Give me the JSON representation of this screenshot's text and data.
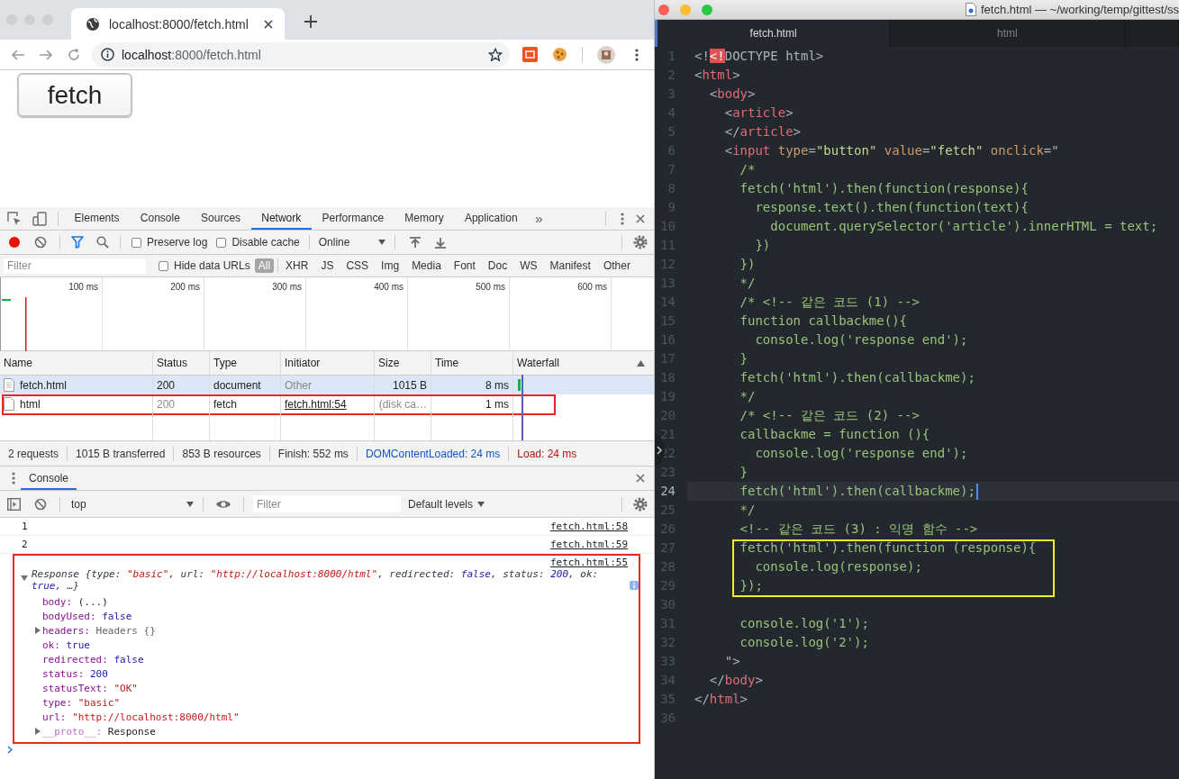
{
  "browser": {
    "tab_title": "localhost:8000/fetch.html",
    "url_host": "localhost",
    "url_path": ":8000/fetch.html"
  },
  "page": {
    "button_label": "fetch"
  },
  "devtools": {
    "tabs": [
      {
        "label": "Elements",
        "selected": false
      },
      {
        "label": "Console",
        "selected": false
      },
      {
        "label": "Sources",
        "selected": false
      },
      {
        "label": "Network",
        "selected": true
      },
      {
        "label": "Performance",
        "selected": false
      },
      {
        "label": "Memory",
        "selected": false
      },
      {
        "label": "Application",
        "selected": false
      }
    ],
    "more": "»",
    "recording": true,
    "preserve_log": {
      "label": "Preserve log",
      "checked": false
    },
    "disable_cache": {
      "label": "Disable cache",
      "checked": false
    },
    "throttling": "Online",
    "filter_placeholder": "Filter",
    "hide_data_urls": {
      "label": "Hide data URLs",
      "checked": false
    },
    "types": [
      {
        "label": "All",
        "selected": true
      },
      {
        "label": "XHR",
        "selected": false
      },
      {
        "label": "JS",
        "selected": false
      },
      {
        "label": "CSS",
        "selected": false
      },
      {
        "label": "Img",
        "selected": false
      },
      {
        "label": "Media",
        "selected": false
      },
      {
        "label": "Font",
        "selected": false
      },
      {
        "label": "Doc",
        "selected": false
      },
      {
        "label": "WS",
        "selected": false
      },
      {
        "label": "Manifest",
        "selected": false
      },
      {
        "label": "Other",
        "selected": false
      }
    ],
    "overview_ticks": [
      "100 ms",
      "200 ms",
      "300 ms",
      "400 ms",
      "500 ms",
      "600 ms"
    ],
    "table": {
      "columns": [
        "Name",
        "Status",
        "Type",
        "Initiator",
        "Size",
        "Time",
        "Waterfall"
      ],
      "rows": [
        {
          "name": "fetch.html",
          "status": "200",
          "type": "document",
          "initiator": "Other",
          "initiator_link": false,
          "size": "1015 B",
          "time": "8 ms",
          "from_cache": false,
          "selected": true,
          "outlined": false
        },
        {
          "name": "html",
          "status": "200",
          "type": "fetch",
          "initiator": "fetch.html:54",
          "initiator_link": true,
          "size": "(disk ca…",
          "time": "1 ms",
          "from_cache": true,
          "selected": false,
          "outlined": true
        }
      ]
    },
    "summary": [
      {
        "text": "2 requests",
        "kind": "plain"
      },
      {
        "text": "1015 B transferred",
        "kind": "plain"
      },
      {
        "text": "853 B resources",
        "kind": "plain"
      },
      {
        "text": "Finish: 552 ms",
        "kind": "plain"
      },
      {
        "text": "DOMContentLoaded: 24 ms",
        "kind": "dcl"
      },
      {
        "text": "Load: 24 ms",
        "kind": "load"
      }
    ]
  },
  "console": {
    "tab": "Console",
    "context": "top",
    "filter_placeholder": "Filter",
    "levels": "Default levels",
    "messages": [
      {
        "kind": "log",
        "text": "1",
        "source": "fetch.html:58",
        "outlined": false
      },
      {
        "kind": "log",
        "text": "2",
        "source": "fetch.html:59",
        "outlined": false
      },
      {
        "kind": "object",
        "source": "fetch.html:55",
        "outlined": true,
        "expanded": true,
        "summary": [
          {
            "text": "Response {type: ",
            "kind": "text"
          },
          {
            "text": "\"basic\"",
            "kind": "string"
          },
          {
            "text": ", url: ",
            "kind": "text"
          },
          {
            "text": "\"http://localhost:8000/html\"",
            "kind": "string"
          },
          {
            "text": ", redirected: ",
            "kind": "text"
          },
          {
            "text": "false",
            "kind": "literal"
          },
          {
            "text": ", status: ",
            "kind": "text"
          },
          {
            "text": "200",
            "kind": "literal"
          },
          {
            "text": ", ok: ",
            "kind": "text"
          },
          {
            "text": "true",
            "kind": "literal"
          },
          {
            "text": ", …}",
            "kind": "text"
          }
        ],
        "properties": [
          {
            "key": "body:",
            "value": {
              "text": "(...)",
              "kind": "plain"
            },
            "kind": "value",
            "internal": false
          },
          {
            "key": "bodyUsed:",
            "value": {
              "text": "false",
              "kind": "literal"
            },
            "kind": "value",
            "internal": false
          },
          {
            "key": "headers:",
            "value": {
              "text": "Headers {}",
              "kind": "object"
            },
            "kind": "expandable",
            "expanded": false,
            "internal": false
          },
          {
            "key": "ok:",
            "value": {
              "text": "true",
              "kind": "literal"
            },
            "kind": "value",
            "internal": false
          },
          {
            "key": "redirected:",
            "value": {
              "text": "false",
              "kind": "literal"
            },
            "kind": "value",
            "internal": false
          },
          {
            "key": "status:",
            "value": {
              "text": "200",
              "kind": "literal"
            },
            "kind": "value",
            "internal": false
          },
          {
            "key": "statusText:",
            "value": {
              "text": "\"OK\"",
              "kind": "string"
            },
            "kind": "value",
            "internal": false
          },
          {
            "key": "type:",
            "value": {
              "text": "\"basic\"",
              "kind": "string"
            },
            "kind": "value",
            "internal": false
          },
          {
            "key": "url:",
            "value": {
              "text": "\"http://localhost:8000/html\"",
              "kind": "string"
            },
            "kind": "value",
            "internal": false
          },
          {
            "key": "__proto__:",
            "value": {
              "text": "Response",
              "kind": "plain"
            },
            "kind": "expandable",
            "expanded": false,
            "internal": true
          }
        ]
      }
    ]
  },
  "editor": {
    "title": "fetch.html — ~/working/temp/gittest/ss",
    "tabs": [
      {
        "label": "fetch.html",
        "selected": true
      },
      {
        "label": "html",
        "selected": false
      }
    ],
    "lines": [
      {
        "kind": "line",
        "number": "1",
        "current": false,
        "tokens": [
          {
            "text": "<!",
            "kind": "plain"
          },
          {
            "text": "<!",
            "kind": "error"
          },
          {
            "text": "DOCTYPE html>",
            "kind": "plain"
          }
        ]
      },
      {
        "kind": "line",
        "number": "2",
        "current": false,
        "tokens": [
          {
            "text": "<",
            "kind": "plain"
          },
          {
            "text": "html",
            "kind": "tag"
          },
          {
            "text": ">",
            "kind": "plain"
          }
        ]
      },
      {
        "kind": "line",
        "number": "3",
        "current": false,
        "tokens": [
          {
            "text": "  <",
            "kind": "plain"
          },
          {
            "text": "body",
            "kind": "tag"
          },
          {
            "text": ">",
            "kind": "plain"
          }
        ]
      },
      {
        "kind": "line",
        "number": "4",
        "current": false,
        "tokens": [
          {
            "text": "    <",
            "kind": "plain"
          },
          {
            "text": "article",
            "kind": "tag"
          },
          {
            "text": ">",
            "kind": "plain"
          }
        ]
      },
      {
        "kind": "line",
        "number": "5",
        "current": false,
        "tokens": [
          {
            "text": "    </",
            "kind": "plain"
          },
          {
            "text": "article",
            "kind": "tag"
          },
          {
            "text": ">",
            "kind": "plain"
          }
        ]
      },
      {
        "kind": "line",
        "number": "6",
        "current": false,
        "tokens": [
          {
            "text": "    <",
            "kind": "plain"
          },
          {
            "text": "input",
            "kind": "tag"
          },
          {
            "text": " type",
            "kind": "attr"
          },
          {
            "text": "=",
            "kind": "plain"
          },
          {
            "text": "\"button\"",
            "kind": "string"
          },
          {
            "text": " value",
            "kind": "attr"
          },
          {
            "text": "=",
            "kind": "plain"
          },
          {
            "text": "\"fetch\"",
            "kind": "string"
          },
          {
            "text": " onclick",
            "kind": "attr"
          },
          {
            "text": "=\"",
            "kind": "plain"
          }
        ]
      },
      {
        "kind": "line",
        "number": "7",
        "current": false,
        "tokens": [
          {
            "text": "      /*",
            "kind": "code"
          }
        ]
      },
      {
        "kind": "line",
        "number": "8",
        "current": false,
        "tokens": [
          {
            "text": "      fetch('html').then(function(response){",
            "kind": "code"
          }
        ]
      },
      {
        "kind": "line",
        "number": "9",
        "current": false,
        "tokens": [
          {
            "text": "        response.text().then(function(text){",
            "kind": "code"
          }
        ]
      },
      {
        "kind": "line",
        "number": "10",
        "current": false,
        "tokens": [
          {
            "text": "          document.querySelector('article').innerHTML = text;",
            "kind": "code"
          }
        ]
      },
      {
        "kind": "line",
        "number": "11",
        "current": false,
        "tokens": [
          {
            "text": "        })",
            "kind": "code"
          }
        ]
      },
      {
        "kind": "line",
        "number": "12",
        "current": false,
        "tokens": [
          {
            "text": "      })",
            "kind": "code"
          }
        ]
      },
      {
        "kind": "line",
        "number": "13",
        "current": false,
        "tokens": [
          {
            "text": "      */",
            "kind": "code"
          }
        ]
      },
      {
        "kind": "line",
        "number": "14",
        "current": false,
        "tokens": [
          {
            "text": "      /* <!-- 같은 코드 (1) -->",
            "kind": "code"
          }
        ]
      },
      {
        "kind": "line",
        "number": "15",
        "current": false,
        "tokens": [
          {
            "text": "      function callbackme(){",
            "kind": "code"
          }
        ]
      },
      {
        "kind": "line",
        "number": "16",
        "current": false,
        "tokens": [
          {
            "text": "        console.log('response end');",
            "kind": "code"
          }
        ]
      },
      {
        "kind": "line",
        "number": "17",
        "current": false,
        "tokens": [
          {
            "text": "      }",
            "kind": "code"
          }
        ]
      },
      {
        "kind": "line",
        "number": "18",
        "current": false,
        "tokens": [
          {
            "text": "      fetch('html').then(callbackme);",
            "kind": "code"
          }
        ]
      },
      {
        "kind": "line",
        "number": "19",
        "current": false,
        "tokens": [
          {
            "text": "      */",
            "kind": "code"
          }
        ]
      },
      {
        "kind": "line",
        "number": "20",
        "current": false,
        "tokens": [
          {
            "text": "      /* <!-- 같은 코드 (2) -->",
            "kind": "code"
          }
        ]
      },
      {
        "kind": "line",
        "number": "21",
        "current": false,
        "tokens": [
          {
            "text": "      callbackme = function (){",
            "kind": "code"
          }
        ]
      },
      {
        "kind": "line",
        "number": "22",
        "current": false,
        "tokens": [
          {
            "text": "        console.log('response end');",
            "kind": "code"
          }
        ]
      },
      {
        "kind": "line",
        "number": "23",
        "current": false,
        "tokens": [
          {
            "text": "      }",
            "kind": "code"
          }
        ]
      },
      {
        "kind": "line",
        "number": "24",
        "current": true,
        "tokens": [
          {
            "text": "      fetch('html').then(callbackme);",
            "kind": "code"
          }
        ]
      },
      {
        "kind": "line",
        "number": "25",
        "current": false,
        "tokens": [
          {
            "text": "      */",
            "kind": "code"
          }
        ]
      },
      {
        "kind": "line",
        "number": "26",
        "current": false,
        "tokens": [
          {
            "text": "      <!-- 같은 코드 (3) : 익명 함수 -->",
            "kind": "code"
          }
        ]
      },
      {
        "kind": "highlight",
        "lines": [
          {
            "number": "27",
            "current": false,
            "tokens": [
              {
                "text": "      fetch('html').then(function (response){",
                "kind": "code"
              }
            ]
          },
          {
            "number": "28",
            "current": false,
            "tokens": [
              {
                "text": "        console.log(response);",
                "kind": "code"
              }
            ]
          },
          {
            "number": "29",
            "current": false,
            "tokens": [
              {
                "text": "      });",
                "kind": "code"
              }
            ]
          }
        ]
      },
      {
        "kind": "line",
        "number": "30",
        "current": false
      },
      {
        "kind": "line",
        "number": "31",
        "current": false,
        "tokens": [
          {
            "text": "      console.log('1');",
            "kind": "code"
          }
        ]
      },
      {
        "kind": "line",
        "number": "32",
        "current": false,
        "tokens": [
          {
            "text": "      console.log('2');",
            "kind": "code"
          }
        ]
      },
      {
        "kind": "line",
        "number": "33",
        "current": false,
        "tokens": [
          {
            "text": "    \">",
            "kind": "plain"
          }
        ]
      },
      {
        "kind": "line",
        "number": "34",
        "current": false,
        "tokens": [
          {
            "text": "  </",
            "kind": "plain"
          },
          {
            "text": "body",
            "kind": "tag"
          },
          {
            "text": ">",
            "kind": "plain"
          }
        ]
      },
      {
        "kind": "line",
        "number": "35",
        "current": false,
        "tokens": [
          {
            "text": "</",
            "kind": "plain"
          },
          {
            "text": "html",
            "kind": "tag"
          },
          {
            "text": ">",
            "kind": "plain"
          }
        ]
      },
      {
        "kind": "line",
        "number": "36",
        "current": false
      }
    ]
  }
}
